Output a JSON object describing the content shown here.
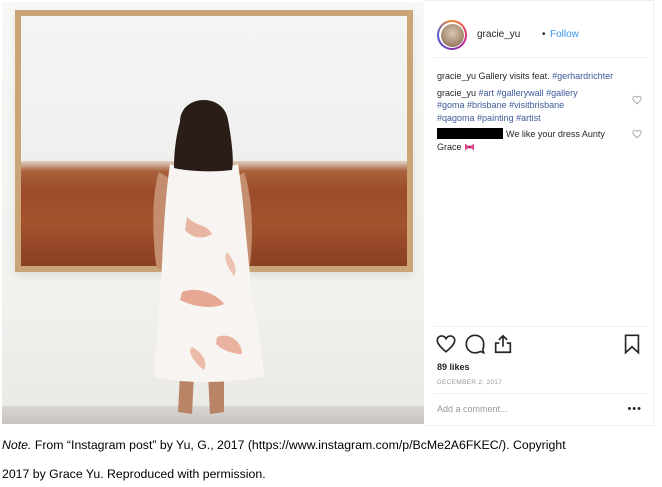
{
  "post": {
    "username": "gracie_yu",
    "separator": "•",
    "follow_label": "Follow",
    "comments": [
      {
        "user": "gracie_yu",
        "text": "Gallery visits feat.",
        "tags": [
          "#gerhardrichter"
        ]
      },
      {
        "user": "gracie_yu",
        "text": "",
        "tags": [
          "#art",
          "#gallerywall",
          "#gallery",
          "#goma",
          "#brisbane",
          "#visitbrisbane",
          "#qagoma",
          "#painting",
          "#artist"
        ]
      },
      {
        "user": "",
        "text": "We like your dress Aunty Grace",
        "emoji": "ribbon"
      }
    ],
    "likes": "89 likes",
    "date": "DECEMBER 2, 2017",
    "add_comment_placeholder": "Add a comment...",
    "more_label": "•••"
  },
  "icons": {
    "like": "heart-icon",
    "comment": "comment-bubble-icon",
    "share": "share-icon",
    "save": "bookmark-icon",
    "comment_like": "small-heart-icon"
  },
  "colors": {
    "link": "#3897f0",
    "hashtag": "#3c5a99",
    "text": "#262626",
    "muted": "#999999"
  },
  "note": {
    "label": "Note.",
    "line1": " From “Instagram post” by Yu, G., 2017 (https://www.instagram.com/p/BcMe2A6FKEC/). Copyright",
    "line2": "2017 by Grace Yu. Reproduced with permission."
  }
}
